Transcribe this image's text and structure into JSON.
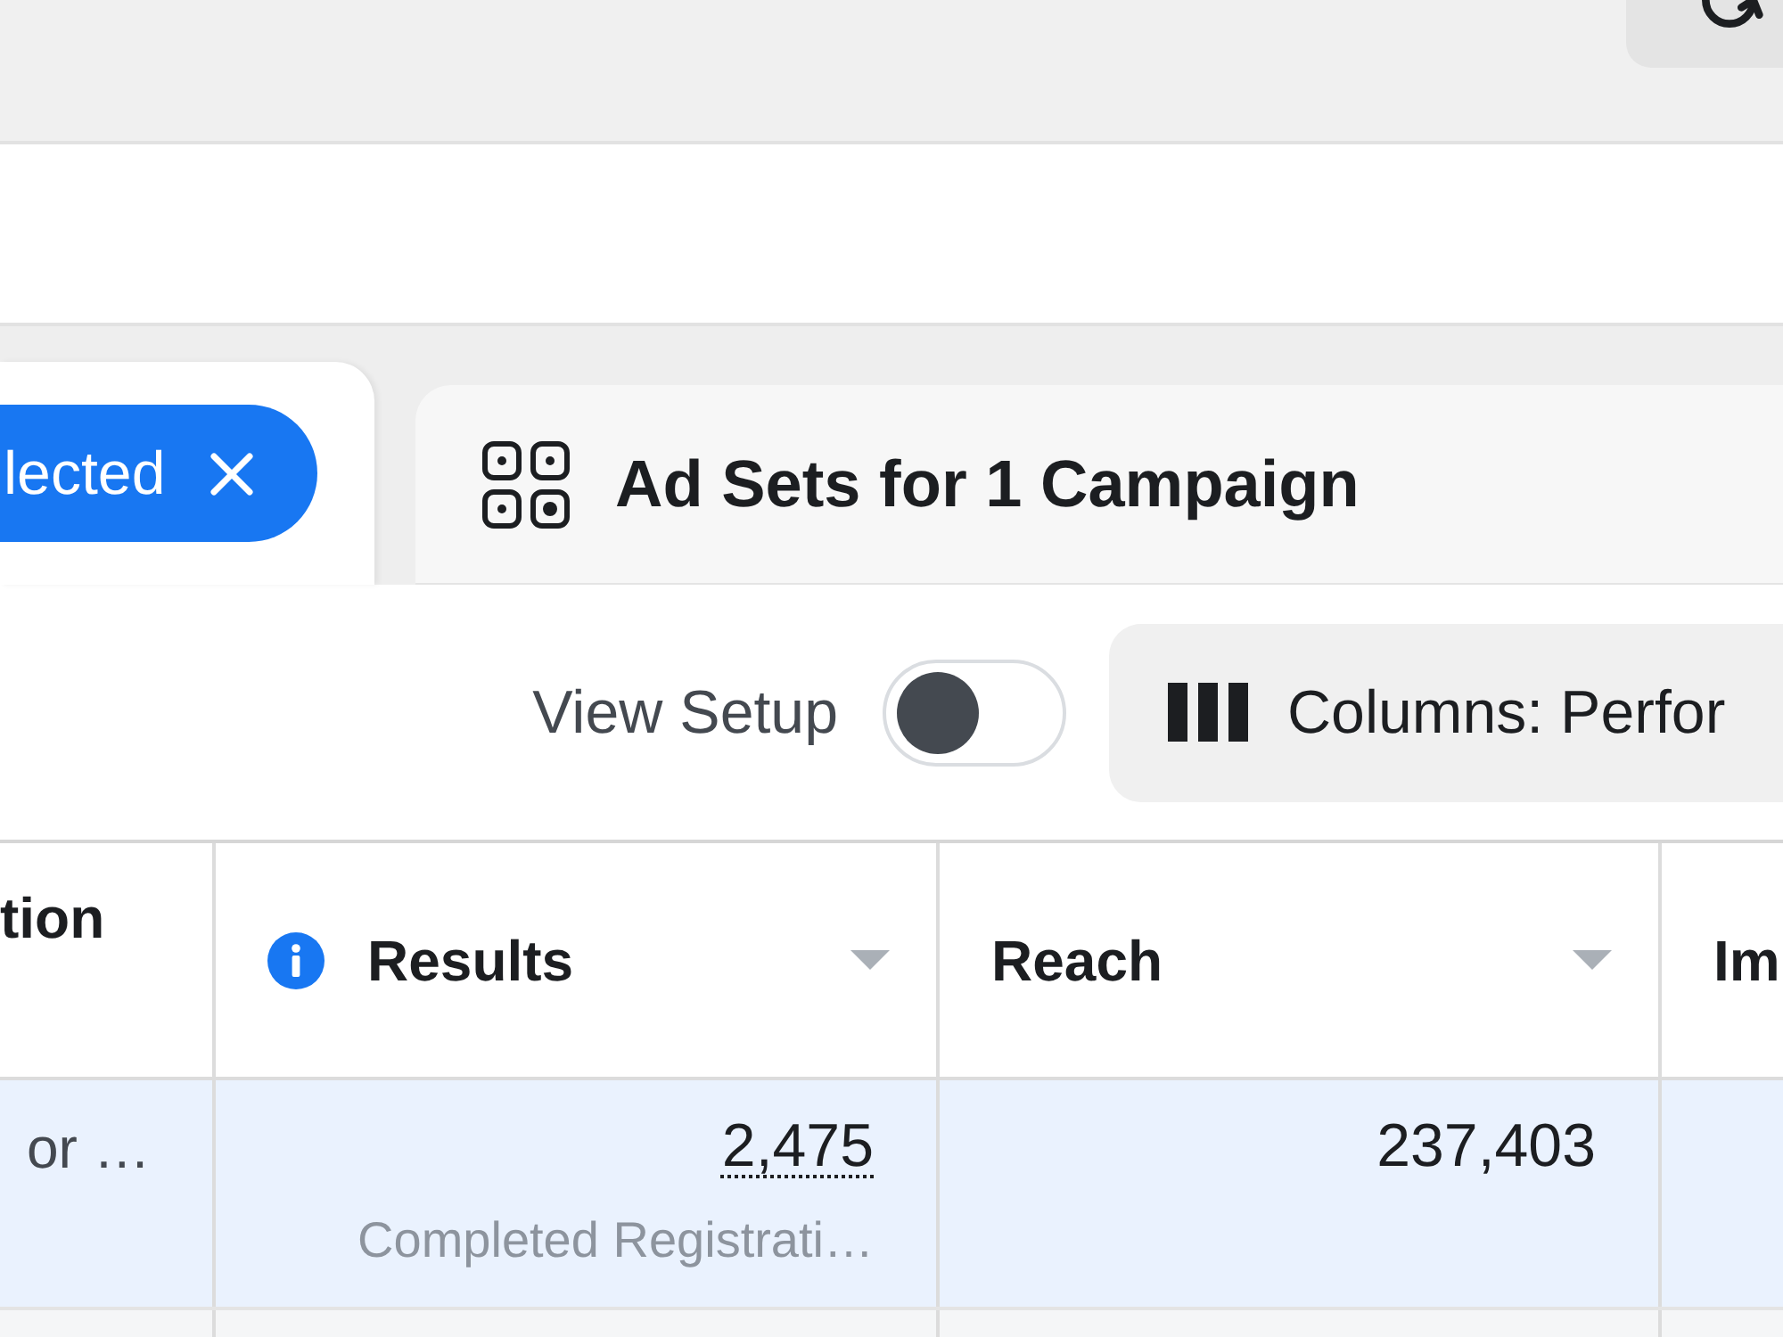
{
  "tabs": [
    {
      "kind": "chip",
      "label": "lected",
      "selected": true
    },
    {
      "kind": "title",
      "label": "Ad Sets for 1 Campaign",
      "selected": false
    }
  ],
  "toolbar": {
    "view_setup": {
      "label": "View Setup",
      "on": false
    },
    "columns_button": {
      "label": "Columns: Perfor"
    }
  },
  "table": {
    "columns": [
      {
        "label": "tion",
        "info": false,
        "sort_menu": false
      },
      {
        "label": "Results",
        "info": true,
        "sort_menu": true
      },
      {
        "label": "Reach",
        "info": false,
        "sort_menu": true
      },
      {
        "label": "Im",
        "info": false,
        "sort_menu": false
      }
    ],
    "rows": [
      {
        "selected": true,
        "cells": [
          {
            "value": "or …"
          },
          {
            "value": "2,475",
            "note": "Completed Registrati…"
          },
          {
            "value": "237,403"
          }
        ]
      }
    ]
  }
}
